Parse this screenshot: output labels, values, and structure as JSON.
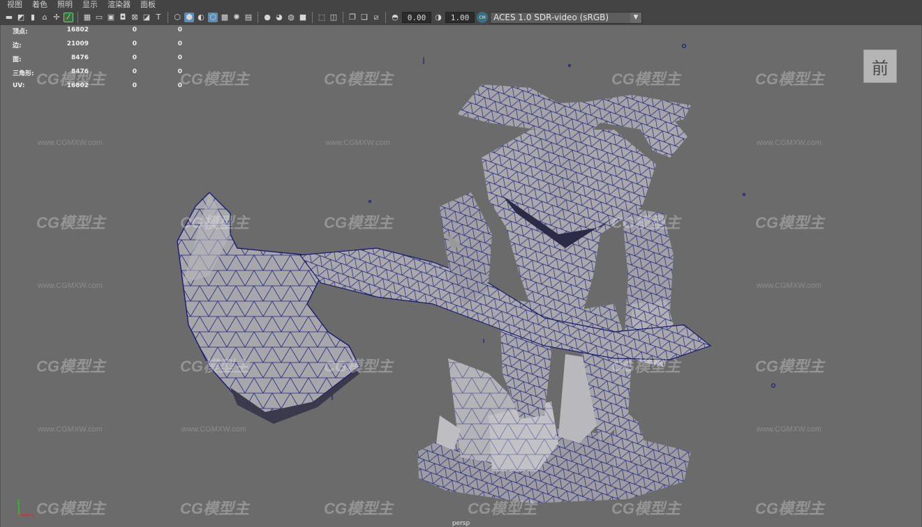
{
  "menu": [
    "视图",
    "着色",
    "照明",
    "显示",
    "渲染器",
    "面板"
  ],
  "toolbar": {
    "exposure_value": "0.00",
    "gamma_value": "1.00",
    "colorspace_badge": "CM",
    "colorspace": "ACES 1.0 SDR-video (sRGB)"
  },
  "hud": {
    "rows": [
      {
        "label": "顶点:",
        "v1": "16802",
        "v2": "0",
        "v3": "0"
      },
      {
        "label": "边:",
        "v1": "21009",
        "v2": "0",
        "v3": "0"
      },
      {
        "label": "面:",
        "v1": "8476",
        "v2": "0",
        "v3": "0"
      },
      {
        "label": "三角形:",
        "v1": "8476",
        "v2": "0",
        "v3": "0"
      },
      {
        "label": "UV:",
        "v1": "16802",
        "v2": "0",
        "v3": "0"
      }
    ]
  },
  "viewcube_label": "前",
  "camera_label": "persp",
  "axis": {
    "y": "y",
    "x": "x"
  },
  "watermark": {
    "logo": "CG模型主",
    "url": "www.CGMXW.com"
  },
  "colors": {
    "viewport_bg": "#6b6b6b",
    "wireframe": "#1f1f7a",
    "mesh_face": "#a9a9ad"
  }
}
